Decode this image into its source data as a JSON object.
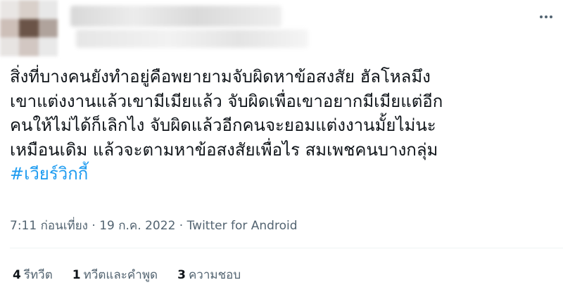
{
  "tweet": {
    "text_lines": [
      "สิ่งที่บางคนยังทำอยู่คือพยายามจับผิดหาข้อสงสัย ฮัลโหลมึง",
      "เขาแต่งงานแล้วเขามีเมียแล้ว จับผิดเพื่อเขาอยากมีเมียแต่อีก",
      "คนให้ไม่ได้ก็เลิกไง จับผิดแล้วอีกคนจะยอมแต่งงานมั้ยไม่นะ",
      "เหมือนเดิม แล้วจะตามหาข้อสงสัยเพื่อไร สมเพชคนบางกลุ่ม"
    ],
    "hashtag": "#เวียร์วิกกี้",
    "time": "7:11 ก่อนเที่ยง",
    "separator": "·",
    "date": "19 ก.ค. 2022",
    "source": "Twitter for Android"
  },
  "stats": {
    "retweets": {
      "count": "4",
      "label": "รีทวีต"
    },
    "quotes": {
      "count": "1",
      "label": "ทวีตและคำพูด"
    },
    "likes": {
      "count": "3",
      "label": "ความชอบ"
    }
  },
  "icons": {
    "more": "more-horizontal-icon"
  },
  "colors": {
    "text": "#0f1419",
    "secondary": "#536471",
    "hashtag": "#1d9bf0",
    "divider": "#eff3f4"
  }
}
